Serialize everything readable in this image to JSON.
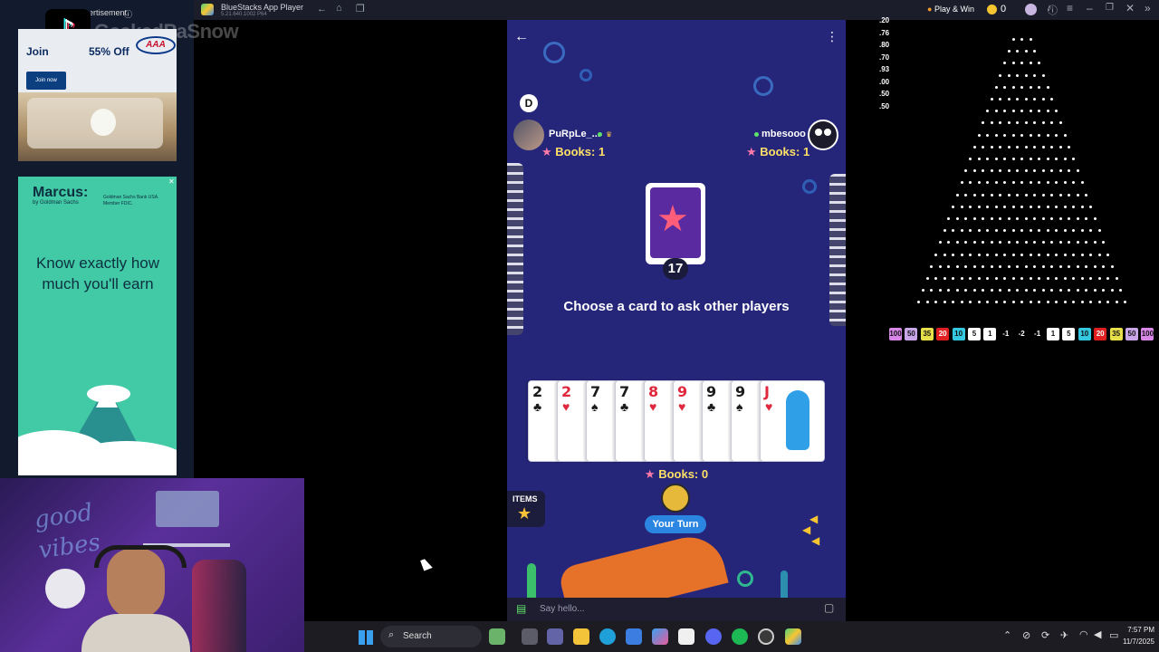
{
  "window": {
    "title": "BlueStacks App Player",
    "version": "5.21.640.1002 P64",
    "play_win": "Play & Win",
    "coins": "0"
  },
  "stream_overlay": {
    "name": "GeekedPaSnow"
  },
  "ads": {
    "label": "Advertisement",
    "aaa": {
      "headline": "Join",
      "offer": "55% Off",
      "logo": "AAA",
      "cta": "Join now"
    },
    "marcus": {
      "brand": "Marcus:",
      "brand_sub": "by Goldman Sachs",
      "disclaimer": "Goldman Sachs Bank USA. Member FDIC.",
      "headline": "Know exactly how much you'll earn"
    }
  },
  "webcam": {
    "neon_text": "good vibes"
  },
  "game": {
    "dealer_badge": "D",
    "players": [
      {
        "name": "PuRpLe_...",
        "books": "Books: 1"
      },
      {
        "name": "mbesooo",
        "books": "Books: 1"
      }
    ],
    "deck_count": "17",
    "prompt": "Choose a card to ask other players",
    "hand": [
      {
        "rank": "2",
        "suit": "♣",
        "color": "black"
      },
      {
        "rank": "2",
        "suit": "♥",
        "color": "red"
      },
      {
        "rank": "7",
        "suit": "♠",
        "color": "black"
      },
      {
        "rank": "7",
        "suit": "♣",
        "color": "black"
      },
      {
        "rank": "8",
        "suit": "♥",
        "color": "red"
      },
      {
        "rank": "9",
        "suit": "♥",
        "color": "red"
      },
      {
        "rank": "9",
        "suit": "♣",
        "color": "black"
      },
      {
        "rank": "9",
        "suit": "♠",
        "color": "black"
      },
      {
        "rank": "J",
        "suit": "♥",
        "color": "red"
      }
    ],
    "my_books": "Books: 0",
    "turn_label": "Your Turn",
    "items_label": "ITEMS",
    "chat_placeholder": "Say hello..."
  },
  "plinko": {
    "multipliers": [
      ".20",
      ".76",
      ".80",
      ".70",
      ".93",
      ".00",
      ".50",
      ".50"
    ],
    "slots": [
      {
        "v": "100",
        "c": "#d887e8"
      },
      {
        "v": "50",
        "c": "#c9a6e8"
      },
      {
        "v": "35",
        "c": "#e8e04a"
      },
      {
        "v": "20",
        "c": "#e02020"
      },
      {
        "v": "10",
        "c": "#33c8e0"
      },
      {
        "v": "5",
        "c": "#ffffff"
      },
      {
        "v": "1",
        "c": "#ffffff"
      },
      {
        "v": "-1",
        "c": "#000000"
      },
      {
        "v": "-2",
        "c": "#000000"
      },
      {
        "v": "-1",
        "c": "#000000"
      },
      {
        "v": "1",
        "c": "#ffffff"
      },
      {
        "v": "5",
        "c": "#ffffff"
      },
      {
        "v": "10",
        "c": "#33c8e0"
      },
      {
        "v": "20",
        "c": "#e02020"
      },
      {
        "v": "35",
        "c": "#e8e04a"
      },
      {
        "v": "50",
        "c": "#c9a6e8"
      },
      {
        "v": "100",
        "c": "#d887e8"
      }
    ]
  },
  "taskbar": {
    "search": "Search",
    "time": "7:57 PM",
    "date": "11/7/2025"
  }
}
